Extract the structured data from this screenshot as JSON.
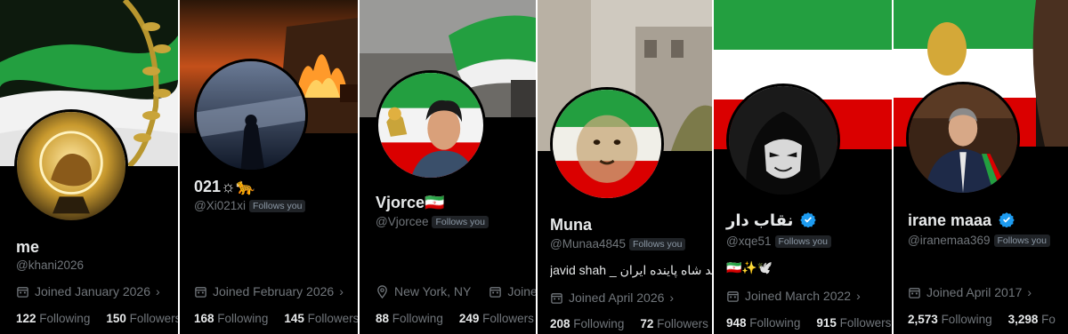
{
  "cards": [
    {
      "name": "me",
      "handle": "@khani2026",
      "follows_you": "",
      "joined": "Joined January 2026",
      "following_count": "122",
      "following_label": "Following",
      "followers_count": "150",
      "followers_label": "Followers"
    },
    {
      "name": "021☼🐆",
      "handle": "@Xi021xi",
      "follows_you": "Follows you",
      "joined": "Joined February 2026",
      "following_count": "168",
      "following_label": "Following",
      "followers_count": "145",
      "followers_label": "Followers"
    },
    {
      "name": "Vjorce🇮🇷",
      "handle": "@Vjorcee",
      "follows_you": "Follows you",
      "location": "New York, NY",
      "joined": "Joined",
      "following_count": "88",
      "following_label": "Following",
      "followers_count": "249",
      "followers_label": "Followers"
    },
    {
      "name": "Muna",
      "handle": "@Munaa4845",
      "follows_you": "Follows you",
      "bio": "javid shah _ جاوید شاه پاینده ایران",
      "joined": "Joined April 2026",
      "following_count": "208",
      "following_label": "Following",
      "followers_count": "72",
      "followers_label": "Followers"
    },
    {
      "name": "نقاب دار",
      "handle": "@xqe51",
      "follows_you": "Follows you",
      "bio": "🇮🇷✨🕊️",
      "joined": "Joined March 2022",
      "following_count": "948",
      "following_label": "Following",
      "followers_count": "915",
      "followers_label": "Followers"
    },
    {
      "name": "irane maaa",
      "handle": "@iranemaa369",
      "follows_you": "Follows you",
      "joined": "Joined April 2017",
      "following_count": "2,573",
      "following_label": "Following",
      "followers_count": "3,298",
      "followers_label": "Fo"
    }
  ],
  "colors": {
    "background": "#000000",
    "text_primary": "#e7e9ea",
    "text_secondary": "#71767b",
    "verified": "#1d9bf0",
    "flag_green": "#239f40",
    "flag_white": "#ffffff",
    "flag_red": "#da0000"
  }
}
